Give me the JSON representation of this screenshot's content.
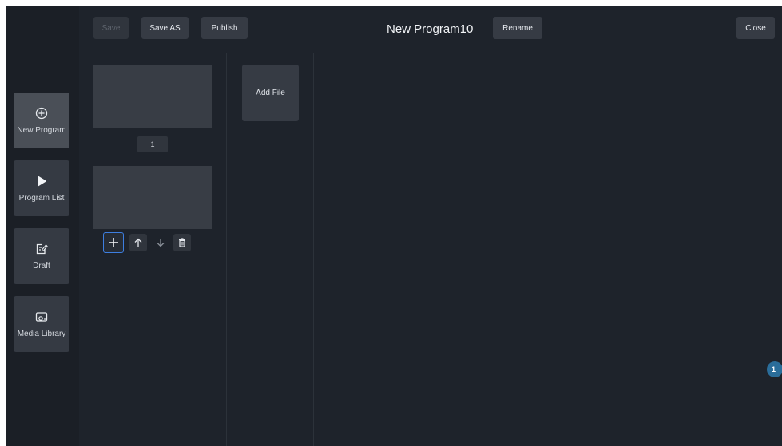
{
  "toolbar": {
    "save_label": "Save",
    "save_as_label": "Save AS",
    "publish_label": "Publish",
    "program_title": "New Program10",
    "rename_label": "Rename",
    "close_label": "Close"
  },
  "sidebar": {
    "items": [
      {
        "label": "New Program",
        "icon": "plus-circle-icon",
        "active": true
      },
      {
        "label": "Program List",
        "icon": "play-icon",
        "active": false
      },
      {
        "label": "Draft",
        "icon": "edit-icon",
        "active": false
      },
      {
        "label": "Media Library",
        "icon": "media-library-icon",
        "active": false
      }
    ]
  },
  "pages": {
    "items": [
      {
        "number": "1"
      }
    ]
  },
  "files": {
    "add_file_label": "Add File"
  },
  "badge": {
    "text": "1"
  },
  "colors": {
    "background": "#1e232b",
    "sidebar": "#1b1f26",
    "button": "#363b44",
    "accent": "#3d7ee0",
    "badge": "#2a6d9a"
  }
}
